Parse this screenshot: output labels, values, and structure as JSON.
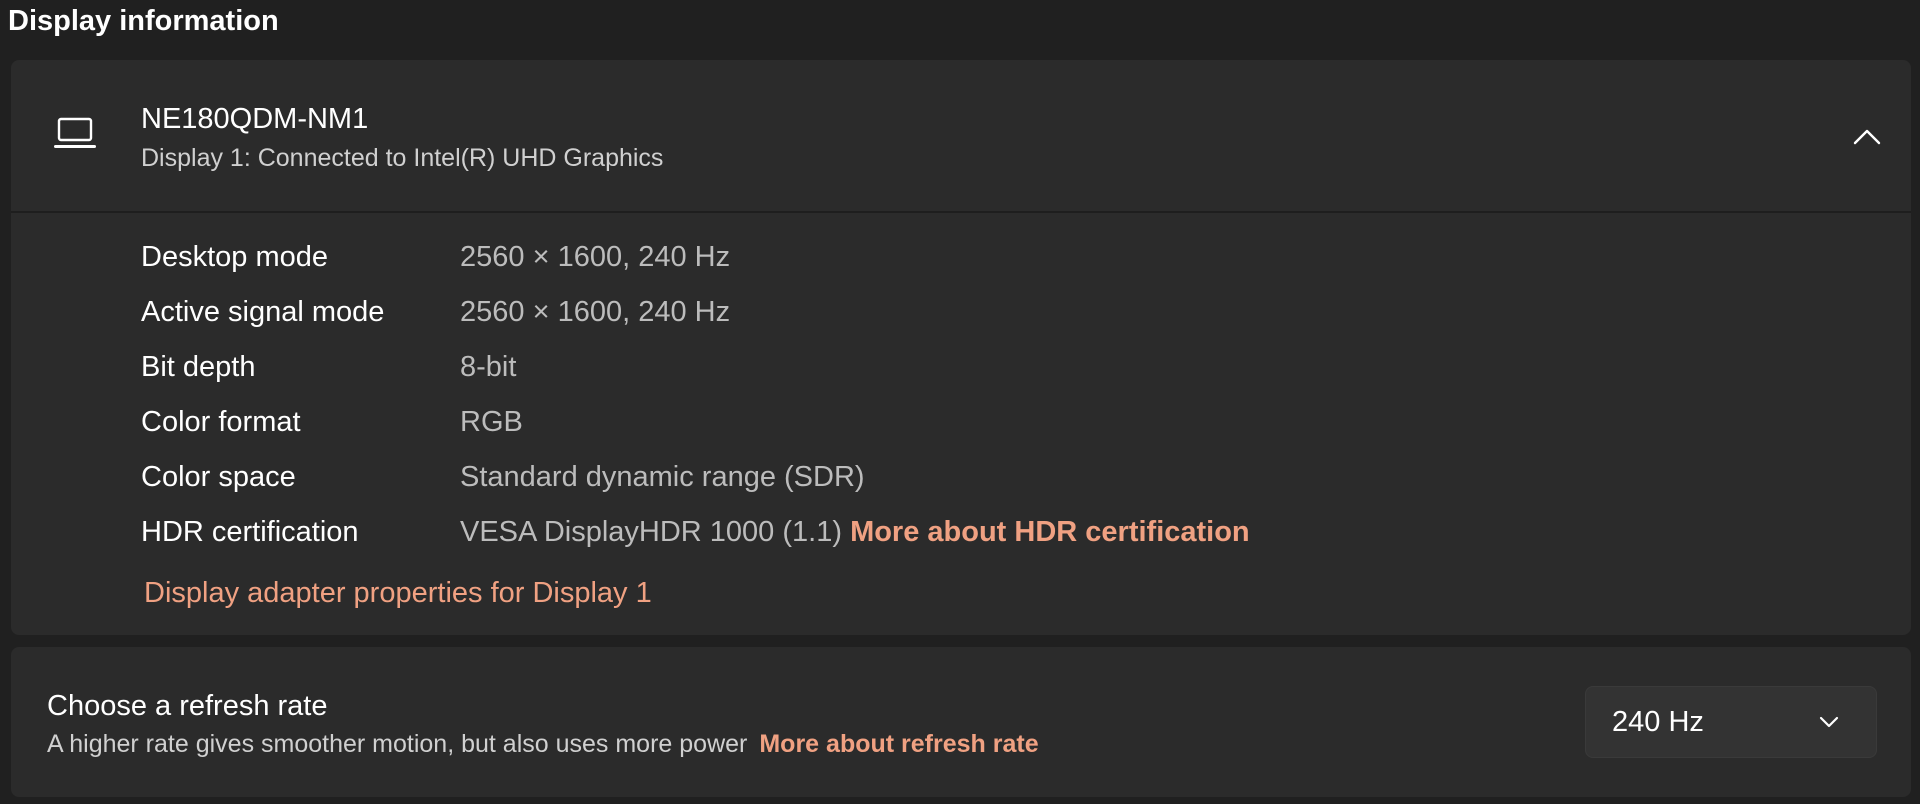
{
  "section": {
    "title": "Display information"
  },
  "display": {
    "icon": "laptop-icon",
    "name": "NE180QDM-NM1",
    "subtitle": "Display 1: Connected to Intel(R) UHD Graphics",
    "expanded": true,
    "collapse_icon": "chevron-up-icon",
    "rows": [
      {
        "label": "Desktop mode",
        "value": "2560 × 1600, 240 Hz"
      },
      {
        "label": "Active signal mode",
        "value": "2560 × 1600, 240 Hz"
      },
      {
        "label": "Bit depth",
        "value": "8-bit"
      },
      {
        "label": "Color format",
        "value": "RGB"
      },
      {
        "label": "Color space",
        "value": "Standard dynamic range (SDR)"
      },
      {
        "label": "HDR certification",
        "value": "VESA DisplayHDR 1000 (1.1)",
        "link": "More about HDR certification"
      }
    ],
    "adapter_link": "Display adapter properties for Display 1"
  },
  "refresh": {
    "title": "Choose a refresh rate",
    "subtitle": "A higher rate gives smoother motion, but also uses more power",
    "link": "More about refresh rate",
    "selected": "240 Hz",
    "dropdown_icon": "chevron-down-icon"
  },
  "colors": {
    "background": "#202020",
    "card": "#2b2b2b",
    "accent_link": "#f0a182",
    "secondary_text": "#bcbcbc"
  }
}
